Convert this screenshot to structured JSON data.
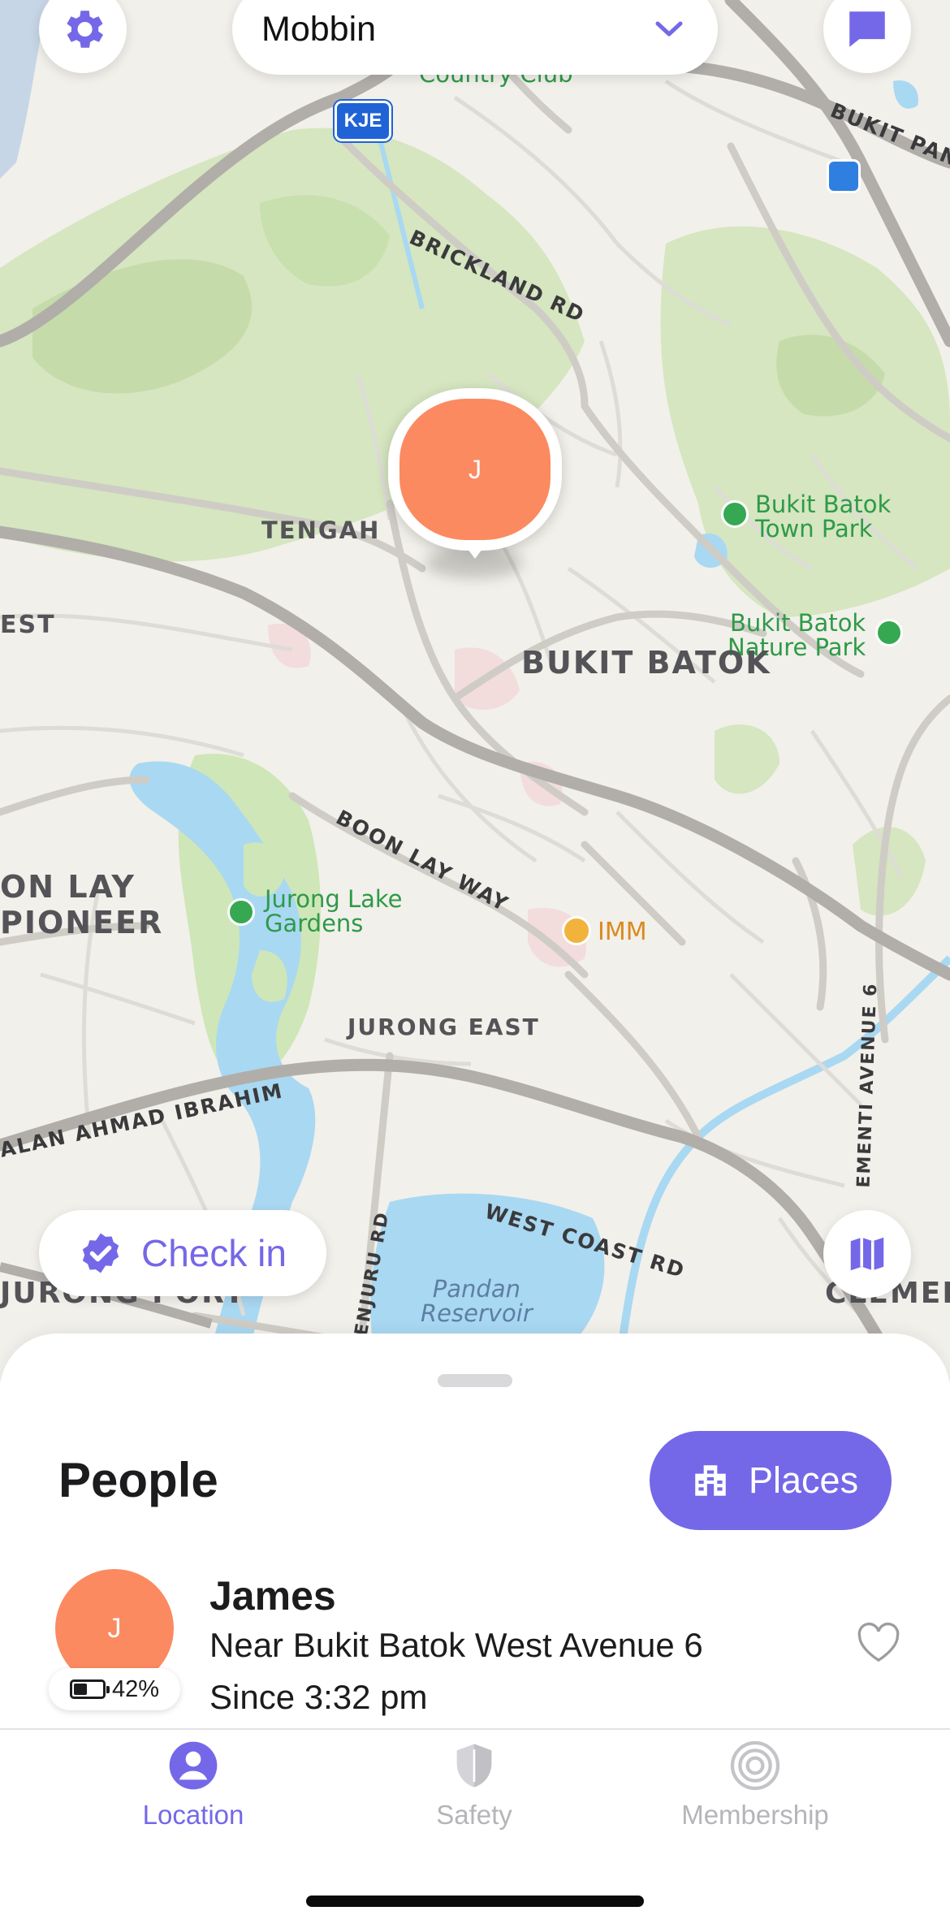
{
  "app": {
    "group_selector": {
      "name": "Mobbin",
      "icon": "chevron-down-icon"
    },
    "settings_icon": "gear-icon",
    "chat_icon": "chat-bubble-icon",
    "map_toggle_icon": "map-icon"
  },
  "map": {
    "labels": {
      "country_club": "Country Club",
      "kje": "KJE",
      "bukit_panjang": "BUKIT PANJ",
      "brickland_rd": "BRICKLAND RD",
      "tengah": "TENGAH",
      "bukit_batok_town_park": [
        "Bukit Batok",
        "Town Park"
      ],
      "bukit_batok_nature_park": [
        "Bukit Batok",
        "Nature Park"
      ],
      "bukit_batok": "BUKIT BATOK",
      "est": "EST",
      "boon_lay_way": "BOON LAY WAY",
      "boon_lay": "ON LAY",
      "pioneer": "PIONEER",
      "jurong_lake_gardens": [
        "Jurong Lake",
        "Gardens"
      ],
      "imm": "IMM",
      "jurong_east": "JURONG EAST",
      "jalan_ahmad_ibrahim": "ALAN AHMAD IBRAHIM",
      "clementi_ave_6": "EMENTI AVENUE 6",
      "west_coast_rd": "WEST COAST RD",
      "penjuru_rd": "PENJURU RD",
      "pandan_reservoir": [
        "Pandan",
        "Reservoir"
      ],
      "jurong_port": "JURONG PORT",
      "clementi": "CLEMENTI"
    },
    "marker": {
      "initial": "J",
      "color": "#fb8a60"
    }
  },
  "checkin": {
    "label": "Check in",
    "icon": "check-badge-icon"
  },
  "sheet": {
    "title": "People",
    "places_button": {
      "label": "Places",
      "icon": "building-icon"
    },
    "people": [
      {
        "initial": "J",
        "name": "James",
        "location": "Near Bukit Batok West Avenue 6",
        "since": "Since 3:32 pm",
        "battery": "42%",
        "battery_level": 0.42
      }
    ]
  },
  "tabs": [
    {
      "label": "Location",
      "icon": "person-pin-icon",
      "active": true
    },
    {
      "label": "Safety",
      "icon": "shield-icon",
      "active": false
    },
    {
      "label": "Membership",
      "icon": "membership-rings-icon",
      "active": false
    }
  ],
  "colors": {
    "accent": "#7468e8",
    "avatar": "#fb8a60",
    "park": "#cfe6b8",
    "water": "#a9d8f2",
    "road": "#d6d4cf"
  }
}
